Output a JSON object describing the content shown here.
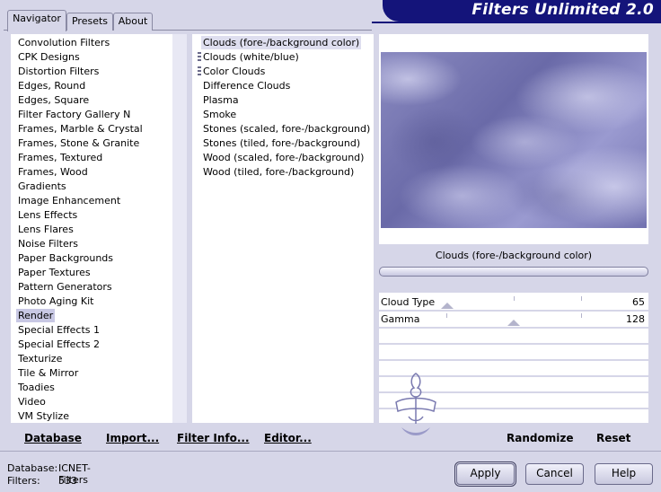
{
  "tabs": [
    "Navigator",
    "Presets",
    "About"
  ],
  "active_tab": "Navigator",
  "app_title": "Filters Unlimited 2.0",
  "categories": [
    "Convolution Filters",
    "CPK Designs",
    "Distortion Filters",
    "Edges, Round",
    "Edges, Square",
    "Filter Factory Gallery N",
    "Frames, Marble & Crystal",
    "Frames, Stone & Granite",
    "Frames, Textured",
    "Frames, Wood",
    "Gradients",
    "Image Enhancement",
    "Lens Effects",
    "Lens Flares",
    "Noise Filters",
    "Paper Backgrounds",
    "Paper Textures",
    "Pattern Generators",
    "Photo Aging Kit",
    "Render",
    "Special Effects 1",
    "Special Effects 2",
    "Texturize",
    "Tile & Mirror",
    "Toadies",
    "Video",
    "VM Stylize"
  ],
  "selected_category": "Render",
  "filters": [
    "Clouds (fore-/background color)",
    "Clouds (white/blue)",
    "Color Clouds",
    "Difference Clouds",
    "Plasma",
    "Smoke",
    "Stones (scaled, fore-/background)",
    "Stones (tiled, fore-/background)",
    "Wood (scaled, fore-/background)",
    "Wood (tiled, fore-/background)"
  ],
  "selected_filter": "Clouds (fore-/background color)",
  "preview_label": "Clouds (fore-/background color)",
  "parameters": [
    {
      "label": "Cloud Type",
      "value": "65"
    },
    {
      "label": "Gamma",
      "value": "128"
    }
  ],
  "menu": {
    "database": "Database",
    "import": "Import...",
    "filter_info": "Filter Info...",
    "editor": "Editor...",
    "randomize": "Randomize",
    "reset": "Reset"
  },
  "status": {
    "database_label": "Database:",
    "database_value": "ICNET-Filters",
    "filters_label": "Filters:",
    "filters_value": "533"
  },
  "buttons": {
    "apply": "Apply",
    "cancel": "Cancel",
    "help": "Help"
  },
  "colors": {
    "accent": "#14147a",
    "background": "#d6d6e8",
    "selection": "#c8c8e4"
  }
}
